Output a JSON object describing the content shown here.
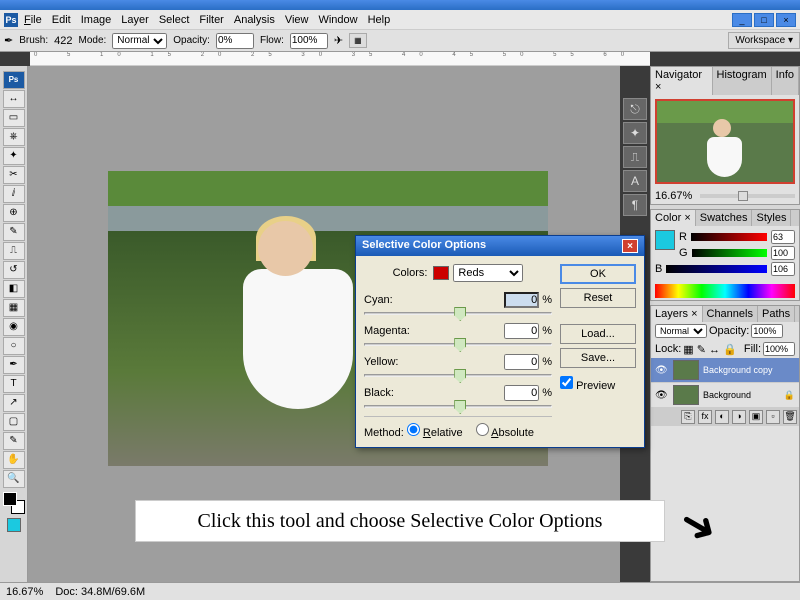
{
  "menubar": {
    "file": "File",
    "edit": "Edit",
    "image": "Image",
    "layer": "Layer",
    "select": "Select",
    "filter": "Filter",
    "analysis": "Analysis",
    "view": "View",
    "window": "Window",
    "help": "Help"
  },
  "optbar": {
    "brush_lbl": "Brush:",
    "brush_val": "422",
    "mode_lbl": "Mode:",
    "mode_val": "Normal",
    "opacity_lbl": "Opacity:",
    "opacity_val": "0%",
    "flow_lbl": "Flow:",
    "flow_val": "100%",
    "workspace": "Workspace ▾"
  },
  "panels": {
    "nav": {
      "tab1": "Navigator ×",
      "tab2": "Histogram",
      "tab3": "Info",
      "zoom": "16.67%"
    },
    "color": {
      "tab1": "Color ×",
      "tab2": "Swatches",
      "tab3": "Styles",
      "r": "63",
      "g": "100",
      "b": "106"
    },
    "layers": {
      "tab1": "Layers ×",
      "tab2": "Channels",
      "tab3": "Paths",
      "blend": "Normal",
      "opacity_lbl": "Opacity:",
      "opacity": "100%",
      "lock_lbl": "Lock:",
      "fill_lbl": "Fill:",
      "fill": "100%",
      "layer1": "Background copy",
      "layer2": "Background"
    }
  },
  "dialog": {
    "title": "Selective Color Options",
    "colors_lbl": "Colors:",
    "colors_val": "Reds",
    "cyan": {
      "lbl": "Cyan:",
      "val": "0",
      "unit": "%"
    },
    "magenta": {
      "lbl": "Magenta:",
      "val": "0",
      "unit": "%"
    },
    "yellow": {
      "lbl": "Yellow:",
      "val": "0",
      "unit": "%"
    },
    "black": {
      "lbl": "Black:",
      "val": "0",
      "unit": "%"
    },
    "method_lbl": "Method:",
    "relative": "Relative",
    "absolute": "Absolute",
    "ok": "OK",
    "reset": "Reset",
    "load": "Load...",
    "save": "Save...",
    "preview": "Preview"
  },
  "callout": "Click this tool and choose Selective Color Options",
  "status": {
    "zoom": "16.67%",
    "doc": "Doc: 34.8M/69.6M"
  }
}
